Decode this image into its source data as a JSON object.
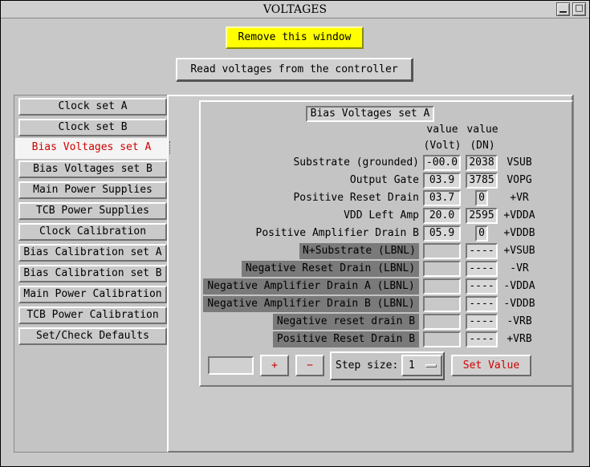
{
  "window": {
    "title": "VOLTAGES",
    "minimize_glyph": "▁",
    "maximize_glyph": "□"
  },
  "actions": {
    "remove_label": "Remove this window",
    "read_label": "Read voltages from the controller"
  },
  "tabs": [
    {
      "label": "Clock set A"
    },
    {
      "label": "Clock set B"
    },
    {
      "label": "Bias Voltages set A",
      "active": true
    },
    {
      "label": "Bias Voltages set B"
    },
    {
      "label": "Main Power Supplies"
    },
    {
      "label": "TCB Power Supplies"
    },
    {
      "label": "Clock Calibration"
    },
    {
      "label": "Bias Calibration set A"
    },
    {
      "label": "Bias Calibration set B"
    },
    {
      "label": "Main Power Calibration"
    },
    {
      "label": "TCB Power Calibration"
    },
    {
      "label": "Set/Check Defaults"
    }
  ],
  "panel": {
    "heading": "Bias Voltages set A",
    "col_volt_top": "value",
    "col_volt_bottom": "(Volt)",
    "col_dn_top": "value",
    "col_dn_bottom": "(DN)",
    "rows": [
      {
        "label": "Substrate  (grounded)",
        "volt": "-00.0",
        "dn": "2038",
        "symbol": "VSUB"
      },
      {
        "label": "Output Gate",
        "volt": "03.9",
        "dn": "3785",
        "symbol": "VOPG"
      },
      {
        "label": "Positive Reset Drain",
        "volt": "03.7",
        "dn": "0",
        "symbol": "+VR"
      },
      {
        "label": "VDD Left Amp",
        "volt": "20.0",
        "dn": "2595",
        "symbol": "+VDDA"
      },
      {
        "label": "Positive Amplifier Drain B",
        "volt": "05.9",
        "dn": "0",
        "symbol": "+VDDB"
      },
      {
        "label": "N+Substrate (LBNL)",
        "volt": "",
        "dn": "----",
        "symbol": "+VSUB"
      },
      {
        "label": "Negative Reset Drain (LBNL)",
        "volt": "",
        "dn": "----",
        "symbol": "-VR"
      },
      {
        "label": "Negative Amplifier Drain A (LBNL)",
        "volt": "",
        "dn": "----",
        "symbol": "-VDDA"
      },
      {
        "label": "Negative Amplifier Drain B (LBNL)",
        "volt": "",
        "dn": "----",
        "symbol": "-VDDB"
      },
      {
        "label": "Negative reset drain B",
        "volt": "",
        "dn": "----",
        "symbol": "-VRB"
      },
      {
        "label": "Positive Reset Drain B",
        "volt": "",
        "dn": "----",
        "symbol": "+VRB"
      }
    ]
  },
  "controls": {
    "stepper_value": "",
    "plus_label": "+",
    "minus_label": "−",
    "step_label": "Step size:",
    "step_value": "1",
    "set_label": "Set Value"
  },
  "colors": {
    "accent_red": "#d10000",
    "remove_bg": "#ffff00",
    "disabled_label_bg": "#7a7a7a"
  }
}
